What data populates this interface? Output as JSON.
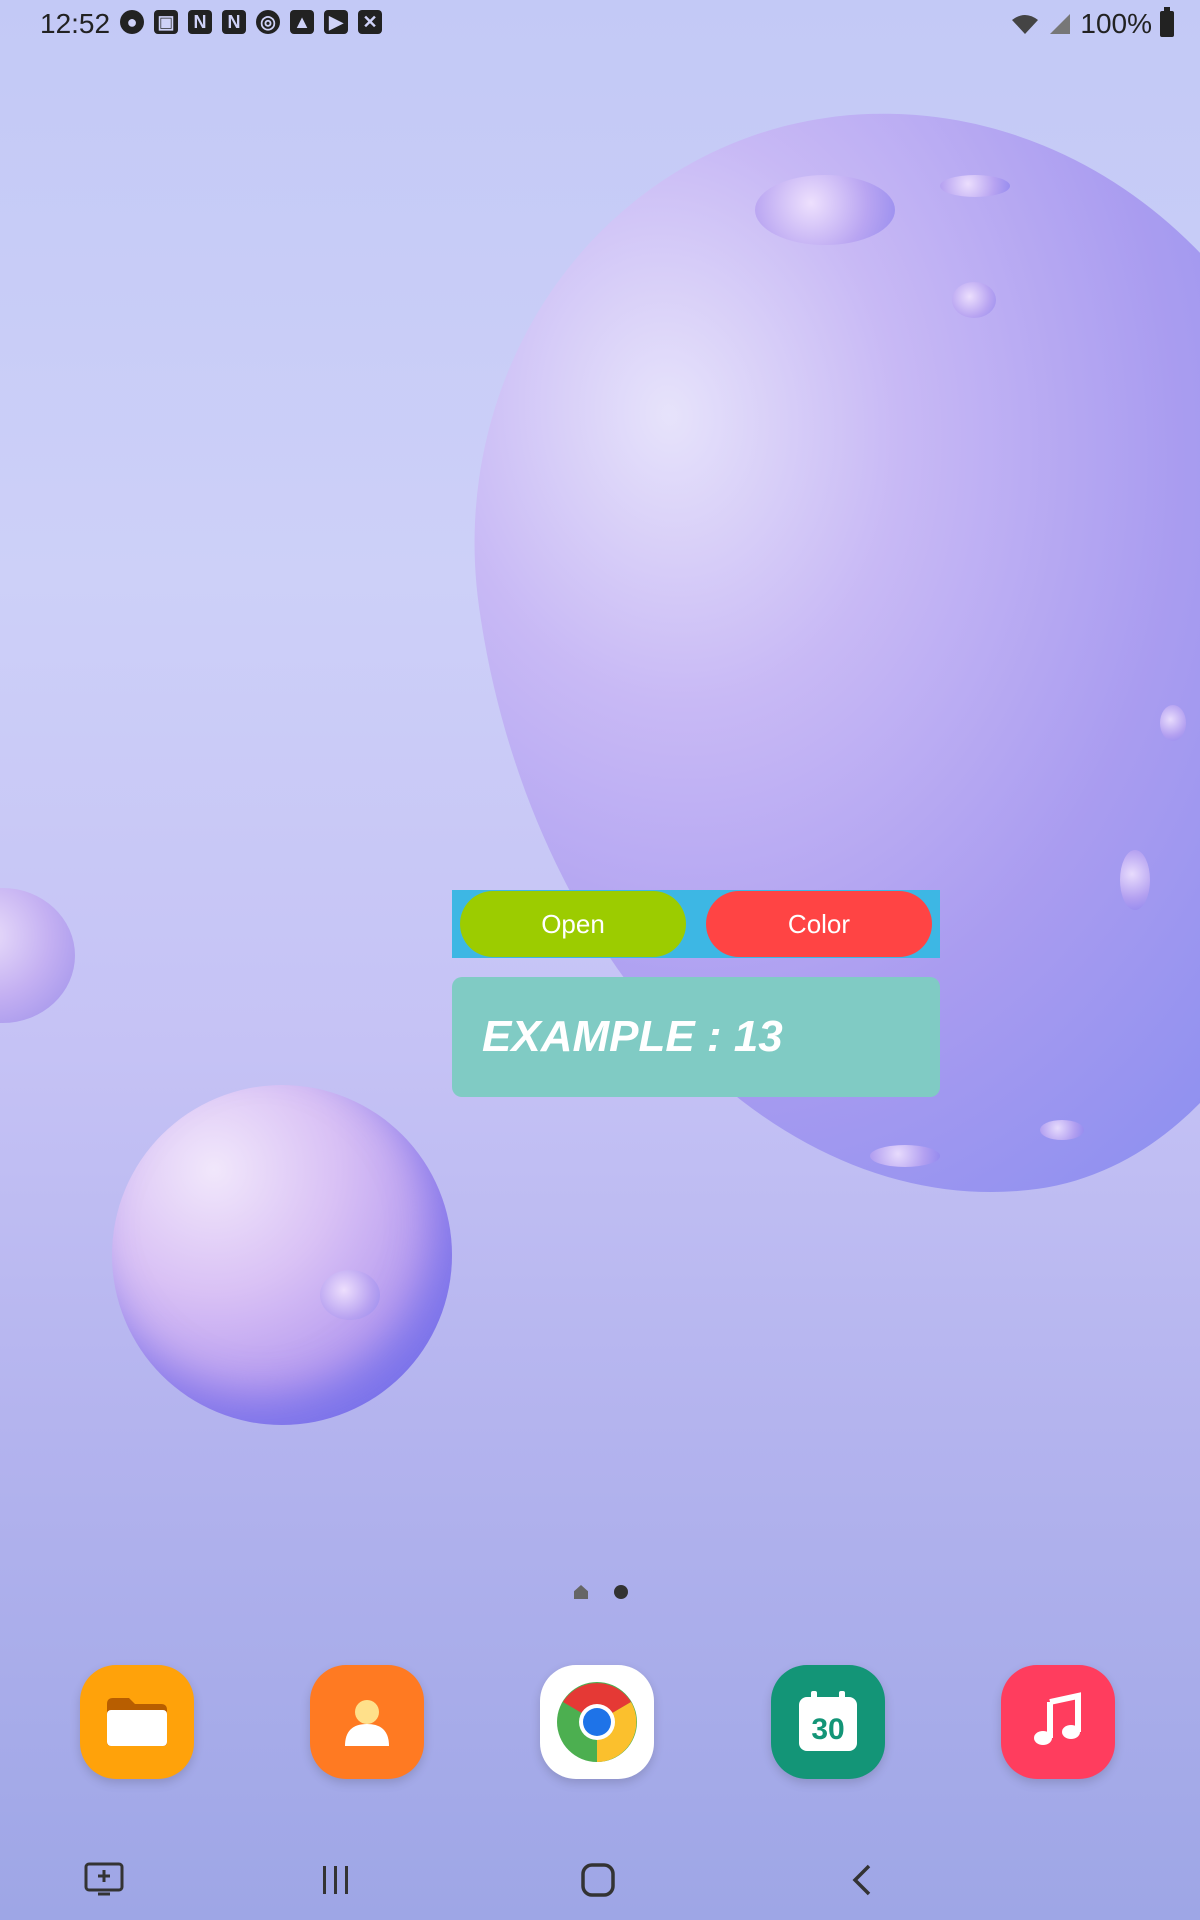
{
  "status_bar": {
    "time": "12:52",
    "battery": "100%",
    "notification_icons": [
      "account-icon",
      "screen-share-icon",
      "netflix-icon",
      "netflix-icon",
      "camera-icon",
      "gallery-icon",
      "youtube-icon",
      "close-icon"
    ]
  },
  "widget": {
    "open_label": "Open",
    "color_label": "Color",
    "example_text": "EXAMPLE : 13",
    "colors": {
      "bar": "#3db7e4",
      "open": "#9ccc00",
      "color": "#ff4444",
      "card": "#80cbc4"
    }
  },
  "page_indicator": {
    "pages": 2,
    "current": 2
  },
  "dock": {
    "apps": [
      "files-icon",
      "contacts-icon",
      "chrome-icon",
      "calendar-icon",
      "music-icon"
    ],
    "calendar_day": "30"
  },
  "nav": [
    "screenshot-icon",
    "recents-icon",
    "home-icon",
    "back-icon"
  ]
}
